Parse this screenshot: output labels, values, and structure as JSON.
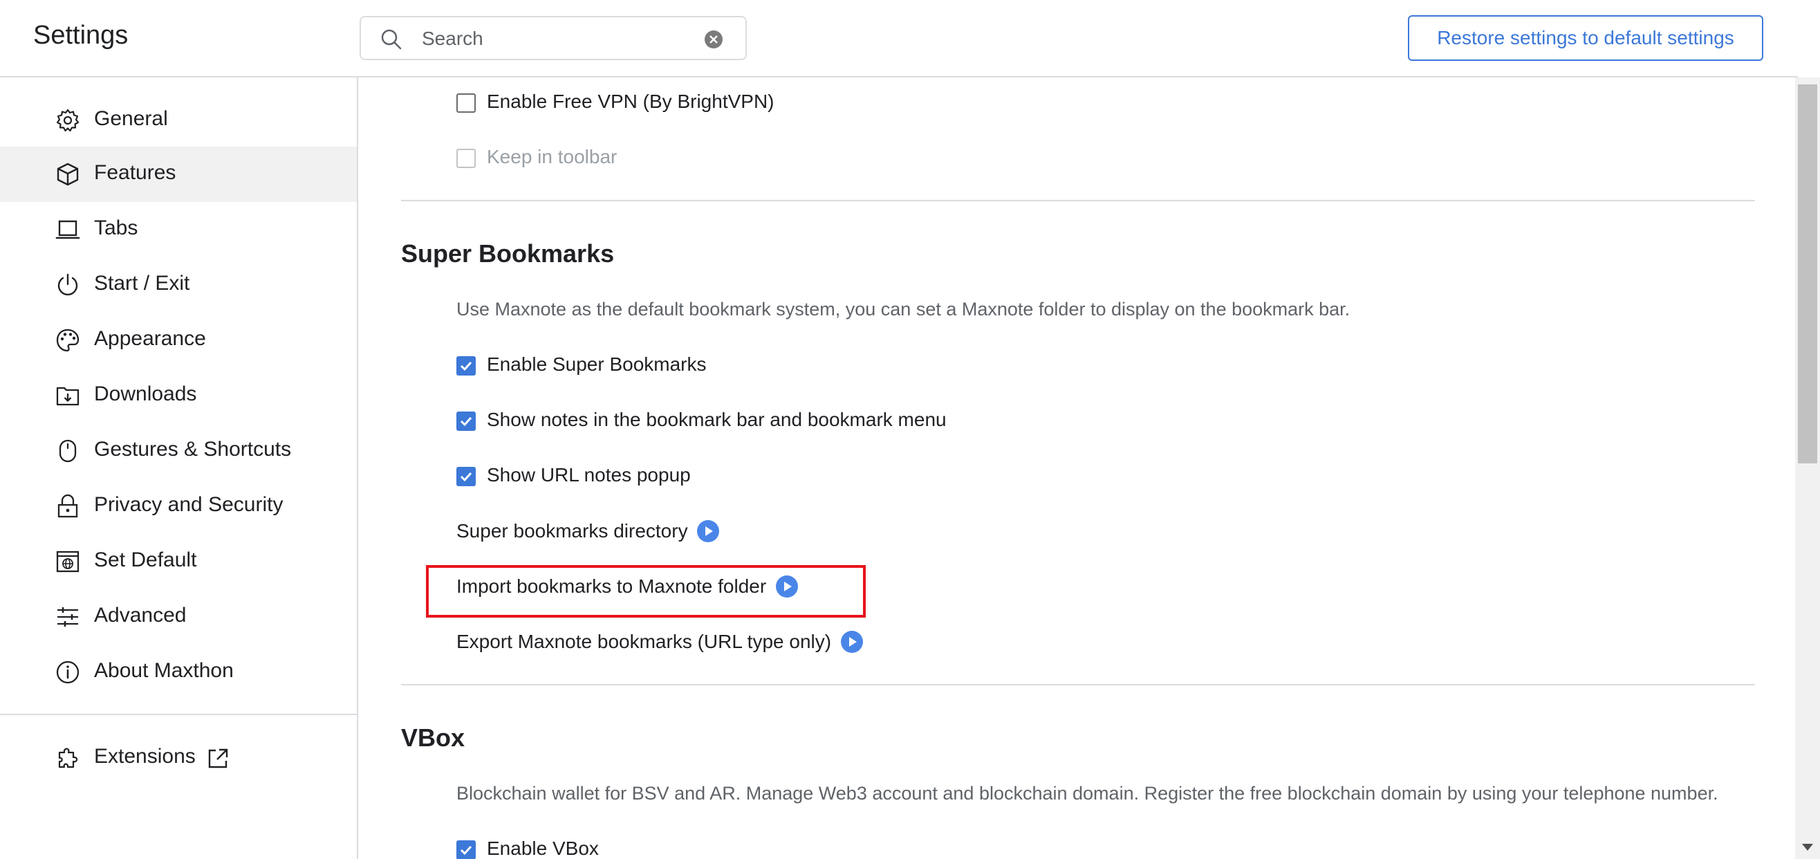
{
  "header": {
    "title": "Settings",
    "search_placeholder": "Search",
    "search_value": "",
    "restore_label": "Restore settings to default settings"
  },
  "sidebar": {
    "items": [
      {
        "label": "General",
        "icon": "gear-icon",
        "active": false
      },
      {
        "label": "Features",
        "icon": "cube-icon",
        "active": true
      },
      {
        "label": "Tabs",
        "icon": "laptop-icon",
        "active": false
      },
      {
        "label": "Start / Exit",
        "icon": "power-icon",
        "active": false
      },
      {
        "label": "Appearance",
        "icon": "palette-icon",
        "active": false
      },
      {
        "label": "Downloads",
        "icon": "download-folder-icon",
        "active": false
      },
      {
        "label": "Gestures & Shortcuts",
        "icon": "mouse-icon",
        "active": false
      },
      {
        "label": "Privacy and Security",
        "icon": "lock-icon",
        "active": false
      },
      {
        "label": "Set Default",
        "icon": "browser-globe-icon",
        "active": false
      },
      {
        "label": "Advanced",
        "icon": "sliders-icon",
        "active": false
      },
      {
        "label": "About Maxthon",
        "icon": "info-icon",
        "active": false
      }
    ],
    "extensions": {
      "label": "Extensions",
      "icon": "puzzle-icon",
      "external_icon": "external-link-icon"
    }
  },
  "vpn": {
    "enable_label": "Enable Free VPN (By BrightVPN)",
    "enable_checked": false,
    "toolbar_label": "Keep in toolbar",
    "toolbar_checked": false,
    "toolbar_disabled": true
  },
  "super_bookmarks": {
    "title": "Super Bookmarks",
    "description": "Use Maxnote as the default bookmark system, you can set a Maxnote folder to display on the bookmark bar.",
    "options": [
      {
        "label": "Enable Super Bookmarks",
        "checked": true
      },
      {
        "label": "Show notes in the bookmark bar and bookmark menu",
        "checked": true
      },
      {
        "label": "Show URL notes popup",
        "checked": true
      }
    ],
    "links": [
      {
        "label": "Super bookmarks directory"
      },
      {
        "label": "Import bookmarks to Maxnote folder"
      },
      {
        "label": "Export Maxnote bookmarks (URL type only)"
      }
    ]
  },
  "vbox": {
    "title": "VBox",
    "description": "Blockchain wallet for BSV and AR. Manage Web3 account and blockchain domain. Register the free blockchain domain by using your telephone number.",
    "enable_label": "Enable VBox",
    "enable_checked": true
  },
  "colors": {
    "accent": "#3c78d8",
    "highlight": "#e8141b",
    "active_nav_bg": "#f1f1f1"
  }
}
